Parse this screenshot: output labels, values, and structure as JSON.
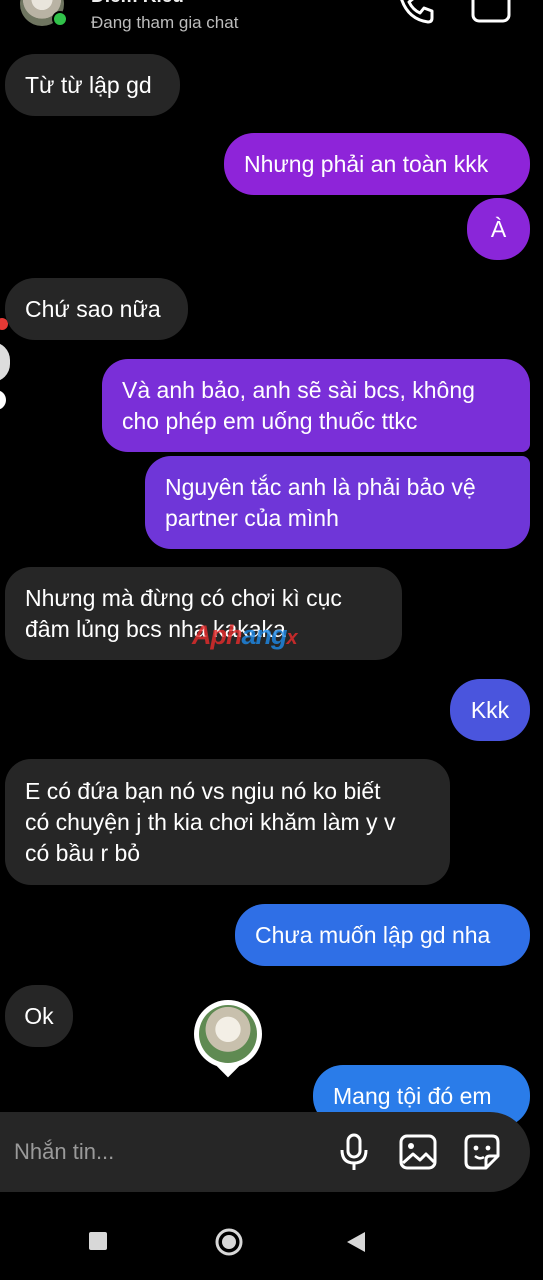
{
  "header": {
    "contact_name": "Diem Kieu",
    "status": "Đang tham gia chat"
  },
  "messages": [
    {
      "side": "in",
      "text": "Từ từ lập gd"
    },
    {
      "side": "out",
      "text": "Nhưng phải an toàn kkk"
    },
    {
      "side": "out",
      "text": "À"
    },
    {
      "side": "in",
      "text": "Chứ sao nữa"
    },
    {
      "side": "out",
      "lines": [
        "Và anh bảo, anh sẽ sài bcs, không",
        "cho phép em uống thuốc ttkc"
      ]
    },
    {
      "side": "out",
      "lines": [
        "Nguyên tắc anh là phải bảo vệ",
        "partner của mình"
      ]
    },
    {
      "side": "in",
      "lines": [
        "Nhưng mà đừng có chơi kì cục",
        "đâm lủng bcs nha kakaka"
      ]
    },
    {
      "side": "out",
      "text": "Kkk"
    },
    {
      "side": "in",
      "lines": [
        "E có đứa bạn nó vs ngiu nó ko biết",
        "có chuyện j th kia chơi khăm làm y v",
        "có bầu r bỏ"
      ]
    },
    {
      "side": "out",
      "text": "Chưa muốn lập gd nha"
    },
    {
      "side": "in",
      "text": "Ok"
    },
    {
      "side": "out",
      "text": "Mang tội đó em"
    }
  ],
  "watermark": {
    "part_a": "Aph",
    "part_b": "ang",
    "part_c": "x"
  },
  "composer": {
    "placeholder": "Nhắn tin..."
  },
  "colors": {
    "incoming": "#262626",
    "outgoing_purple": "#8e24d9",
    "outgoing_violet": "#6f36d8",
    "outgoing_blue": "#2f6fe6",
    "online": "#31c24a"
  }
}
